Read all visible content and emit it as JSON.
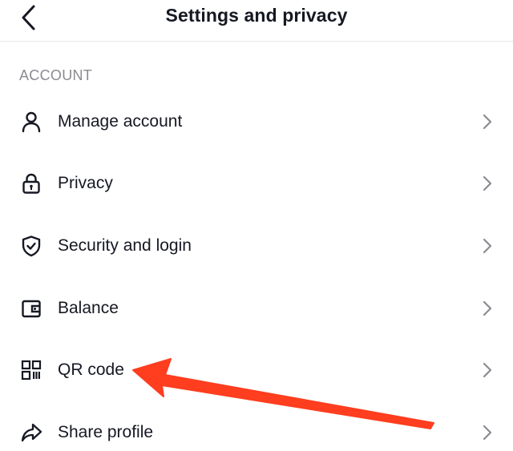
{
  "header": {
    "title": "Settings and privacy",
    "back_icon": "chevron-left-icon"
  },
  "account_section": {
    "label": "ACCOUNT",
    "items": [
      {
        "label": "Manage account",
        "icon": "person-icon"
      },
      {
        "label": "Privacy",
        "icon": "lock-icon"
      },
      {
        "label": "Security and login",
        "icon": "shield-check-icon"
      },
      {
        "label": "Balance",
        "icon": "wallet-icon"
      },
      {
        "label": "QR code",
        "icon": "qr-code-icon"
      },
      {
        "label": "Share profile",
        "icon": "share-arrow-icon"
      }
    ]
  },
  "annotation": {
    "arrow_color": "#fe3e1f",
    "points_to": "QR code"
  },
  "colors": {
    "text": "#161823",
    "muted": "#8a8b91",
    "chevron": "#8a8b91",
    "divider": "#e6e6e8"
  }
}
